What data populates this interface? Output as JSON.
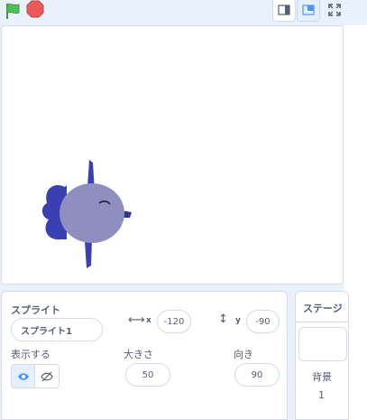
{
  "sprite_info": {
    "section_title": "スプライト",
    "name": "スプライト1",
    "x_label": "x",
    "x_value": "-120",
    "y_label": "y",
    "y_value": "-90",
    "show_label": "表示する",
    "size_label": "大きさ",
    "size_value": "50",
    "direction_label": "向き",
    "direction_value": "90"
  },
  "stage_panel": {
    "title": "ステージ",
    "backdrop_label": "背景",
    "backdrop_count": "1"
  },
  "colors": {
    "accent": "#4c97ff",
    "flag": "#4cbf56",
    "stop": "#ec5959",
    "sprite_body": "#8f8fbf",
    "sprite_fins": "#3a40b3"
  },
  "icons": [
    "green-flag-icon",
    "stop-icon",
    "small-stage-icon",
    "large-stage-icon",
    "fullscreen-icon",
    "eye-icon",
    "eye-slash-icon",
    "horizontal-arrows-icon",
    "vertical-arrows-icon"
  ]
}
